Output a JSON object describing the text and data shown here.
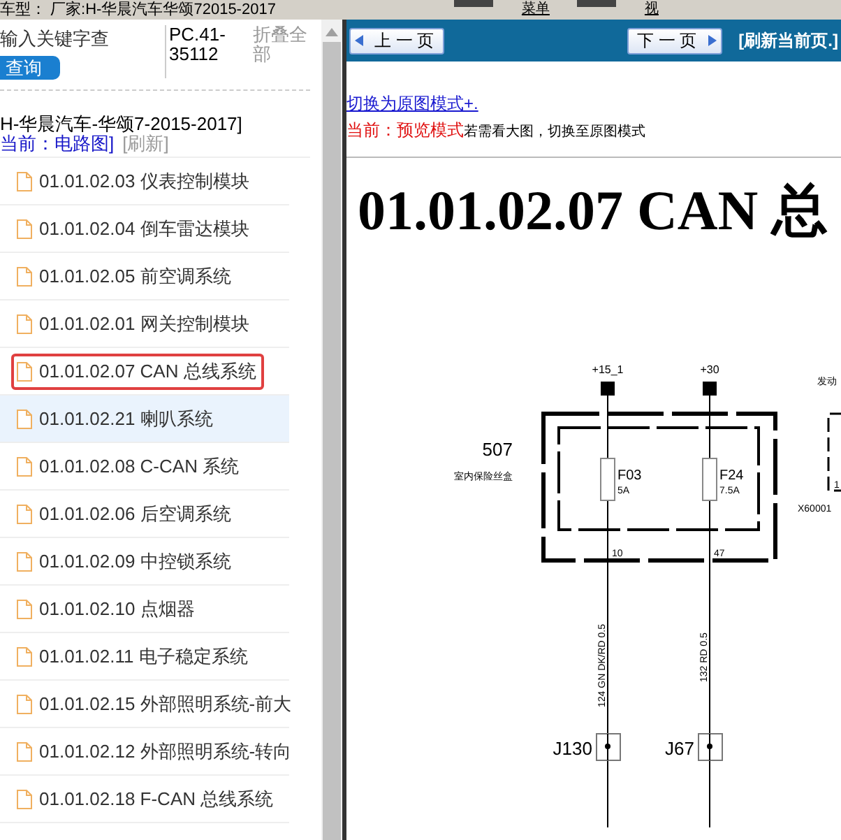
{
  "header": {
    "vehicle": "车型： 厂家:H-华晨汽车华颂72015-2017",
    "menus": [
      "菜单",
      "视"
    ]
  },
  "sidebar": {
    "search": {
      "placeholder": "输入关键字查"
    },
    "search_button": "查询",
    "code": "PC.41-35112",
    "collapse_all": "折叠全部",
    "breadcrumb": "H-华晨汽车-华颂7-2015-2017]",
    "current": "当前：电路图]",
    "refresh": "[刷新]",
    "items": [
      {
        "label": "01.01.02.03 仪表控制模块",
        "selected": false,
        "highlighted": false
      },
      {
        "label": "01.01.02.04 倒车雷达模块",
        "selected": false,
        "highlighted": false
      },
      {
        "label": "01.01.02.05 前空调系统",
        "selected": false,
        "highlighted": false
      },
      {
        "label": "01.01.02.01 网关控制模块",
        "selected": false,
        "highlighted": false
      },
      {
        "label": "01.01.02.07 CAN 总线系统",
        "selected": true,
        "highlighted": false
      },
      {
        "label": "01.01.02.21 喇叭系统",
        "selected": false,
        "highlighted": true
      },
      {
        "label": "01.01.02.08 C-CAN 系统",
        "selected": false,
        "highlighted": false
      },
      {
        "label": "01.01.02.06 后空调系统",
        "selected": false,
        "highlighted": false
      },
      {
        "label": "01.01.02.09 中控锁系统",
        "selected": false,
        "highlighted": false
      },
      {
        "label": "01.01.02.10 点烟器",
        "selected": false,
        "highlighted": false
      },
      {
        "label": "01.01.02.11 电子稳定系统",
        "selected": false,
        "highlighted": false
      },
      {
        "label": "01.01.02.15 外部照明系统-前大",
        "selected": false,
        "highlighted": false
      },
      {
        "label": "01.01.02.12 外部照明系统-转向",
        "selected": false,
        "highlighted": false
      },
      {
        "label": "01.01.02.18 F-CAN 总线系统",
        "selected": false,
        "highlighted": false
      }
    ]
  },
  "toolbar": {
    "prev": "上 一 页",
    "next": "下 一 页",
    "refresh": "[刷新当前页.]"
  },
  "viewer": {
    "switch_link": "切换为原图模式+.",
    "mode": "当前：预览模式",
    "hint": "若需看大图，切换至原图模式",
    "title": "01.01.02.07 CAN 总",
    "diagram": {
      "supplies": [
        "+15_1",
        "+30"
      ],
      "side_label": "发动",
      "block_number": "507",
      "block_name": "室内保险丝盒",
      "fuses": [
        {
          "name": "F03",
          "rating": "5A",
          "pin": "10",
          "wire": "124 GN DK/RD 0.5",
          "connector": "J130"
        },
        {
          "name": "F24",
          "rating": "7.5A",
          "pin": "47",
          "wire": "132 RD 0.5",
          "connector": "J67"
        }
      ],
      "side_pin": "1",
      "side_connector": "X60001"
    }
  }
}
